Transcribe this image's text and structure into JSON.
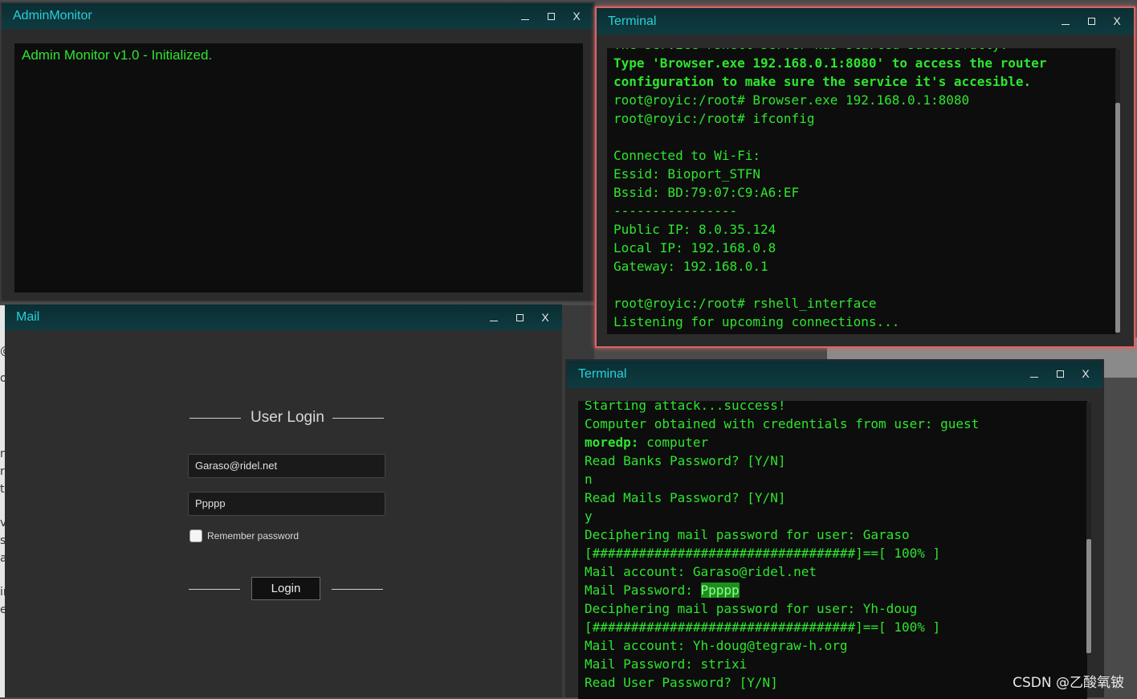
{
  "admin_monitor": {
    "title": "AdminMonitor",
    "message": "Admin Monitor v1.0 - Initialized."
  },
  "window_controls": {
    "minimize": "_",
    "close": "X"
  },
  "terminal_top": {
    "title": "Terminal",
    "lines": [
      {
        "text": "The service rshell server has started successfully.",
        "bold": false
      },
      {
        "text": "Type 'Browser.exe 192.168.0.1:8080' to access the router",
        "bold": true
      },
      {
        "text": "configuration to make sure the service it's accesible.",
        "bold": true
      },
      {
        "text": "root@royic:/root# Browser.exe 192.168.0.1:8080",
        "bold": false
      },
      {
        "text": "root@royic:/root# ifconfig",
        "bold": false
      },
      {
        "text": "",
        "bold": false
      },
      {
        "text": "Connected to Wi-Fi:",
        "bold": false
      },
      {
        "text": "Essid: Bioport_STFN",
        "bold": false
      },
      {
        "text": "Bssid: BD:79:07:C9:A6:EF",
        "bold": false
      },
      {
        "text": "----------------",
        "bold": false
      },
      {
        "text": "Public IP: 8.0.35.124",
        "bold": false
      },
      {
        "text": "Local IP: 192.168.0.8",
        "bold": false
      },
      {
        "text": "Gateway: 192.168.0.1",
        "bold": false
      },
      {
        "text": "",
        "bold": false
      },
      {
        "text": "root@royic:/root# rshell_interface",
        "bold": false
      },
      {
        "text": "Listening for upcoming connections...",
        "bold": false
      }
    ]
  },
  "mail": {
    "title": "Mail",
    "login_title": "User Login",
    "email_value": "Garaso@ridel.net",
    "password_value": "Ppppp",
    "remember_label": "Remember password",
    "login_button": "Login"
  },
  "terminal_bottom": {
    "title": "Terminal",
    "lines": [
      {
        "text": "Starting attack...success!"
      },
      {
        "text": "Computer obtained with credentials from user: guest"
      },
      {
        "prefix": "moredp:",
        "text": " computer"
      },
      {
        "text": "Read Banks Password? [Y/N]"
      },
      {
        "text": "n"
      },
      {
        "text": "Read Mails Password? [Y/N]"
      },
      {
        "text": "y"
      },
      {
        "text": "Deciphering mail password for user: Garaso"
      },
      {
        "text": "[##################################]==[ 100% ]"
      },
      {
        "text": "Mail account: Garaso@ridel.net"
      },
      {
        "text": "Mail Password: ",
        "highlight": "Ppppp"
      },
      {
        "text": "Deciphering mail password for user: Yh-doug"
      },
      {
        "text": "[##################################]==[ 100% ]"
      },
      {
        "text": "Mail account: Yh-doug@tegraw-h.org"
      },
      {
        "text": "Mail Password: strixi"
      },
      {
        "text": "Read User Password? [Y/N]"
      }
    ]
  },
  "background_fragments": [
    "@",
    "o",
    "nt",
    "re",
    "t",
    "v",
    "s",
    "a",
    "ir",
    "e"
  ],
  "watermark": "CSDN @乙酸氧铍"
}
